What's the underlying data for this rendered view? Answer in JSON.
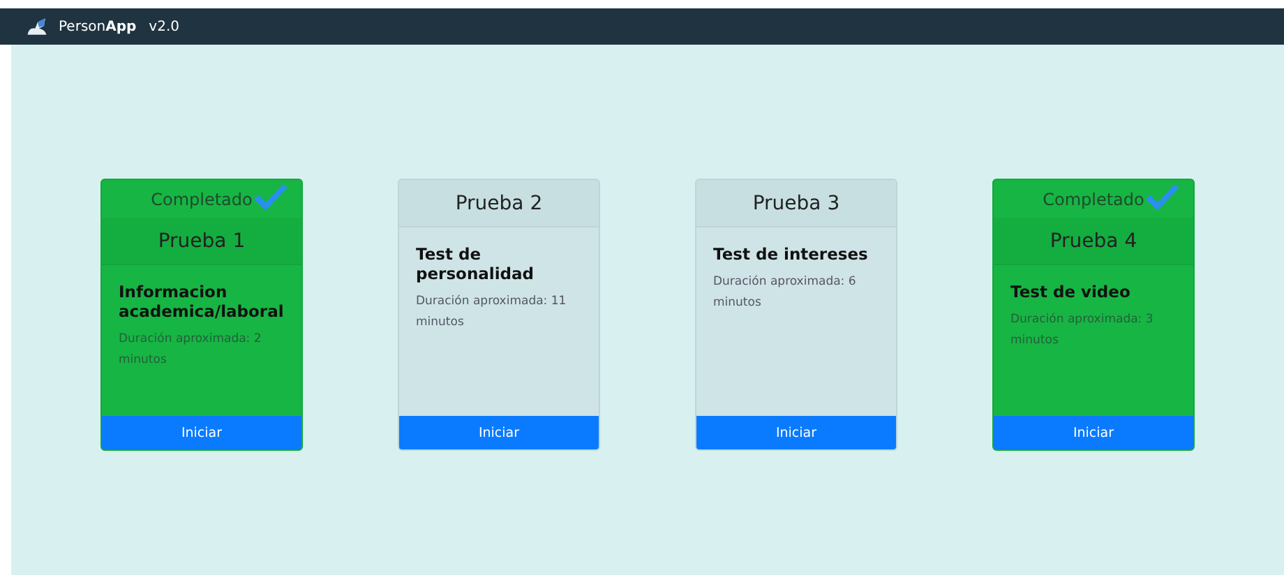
{
  "navbar": {
    "brand_plain": "Person",
    "brand_bold": "App",
    "version": "v2.0"
  },
  "cards": [
    {
      "completed": true,
      "status": "Completado",
      "title": "Prueba 1",
      "subtitle": "Informacion academica/laboral",
      "duration": "Duración aproximada: 2 minutos",
      "button": "Iniciar"
    },
    {
      "completed": false,
      "title": "Prueba 2",
      "subtitle": "Test de personalidad",
      "duration": "Duración aproximada: 11 minutos",
      "button": "Iniciar"
    },
    {
      "completed": false,
      "title": "Prueba 3",
      "subtitle": "Test de intereses",
      "duration": "Duración aproximada: 6 minutos",
      "button": "Iniciar"
    },
    {
      "completed": true,
      "status": "Completado",
      "title": "Prueba 4",
      "subtitle": "Test de video",
      "duration": "Duración aproximada: 3 minutos",
      "button": "Iniciar"
    }
  ]
}
